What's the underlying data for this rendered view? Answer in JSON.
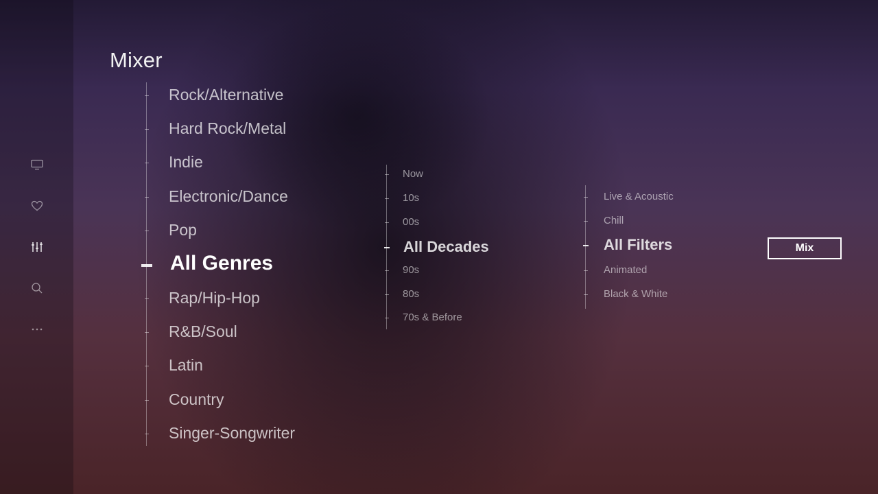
{
  "header": {
    "title": "Mixer"
  },
  "sidebar": {
    "items": [
      {
        "name": "tv-icon"
      },
      {
        "name": "heart-icon"
      },
      {
        "name": "mixer-sliders-icon",
        "active": true
      },
      {
        "name": "search-icon"
      },
      {
        "name": "more-icon"
      }
    ]
  },
  "genres": {
    "items": [
      "Rock/Alternative",
      "Hard Rock/Metal",
      "Indie",
      "Electronic/Dance",
      "Pop",
      "All Genres",
      "Rap/Hip-Hop",
      "R&B/Soul",
      "Latin",
      "Country",
      "Singer-Songwriter"
    ],
    "selected": "All Genres"
  },
  "decades": {
    "items": [
      "Now",
      "10s",
      "00s",
      "All Decades",
      "90s",
      "80s",
      "70s & Before"
    ],
    "selected": "All Decades"
  },
  "filters": {
    "items": [
      "Live & Acoustic",
      "Chill",
      "All Filters",
      "Animated",
      "Black & White"
    ],
    "selected": "All Filters"
  },
  "actions": {
    "mix_label": "Mix"
  },
  "colors": {
    "accent": "#ffffff",
    "background_top": "#231a35",
    "background_bottom": "#4a2428"
  }
}
